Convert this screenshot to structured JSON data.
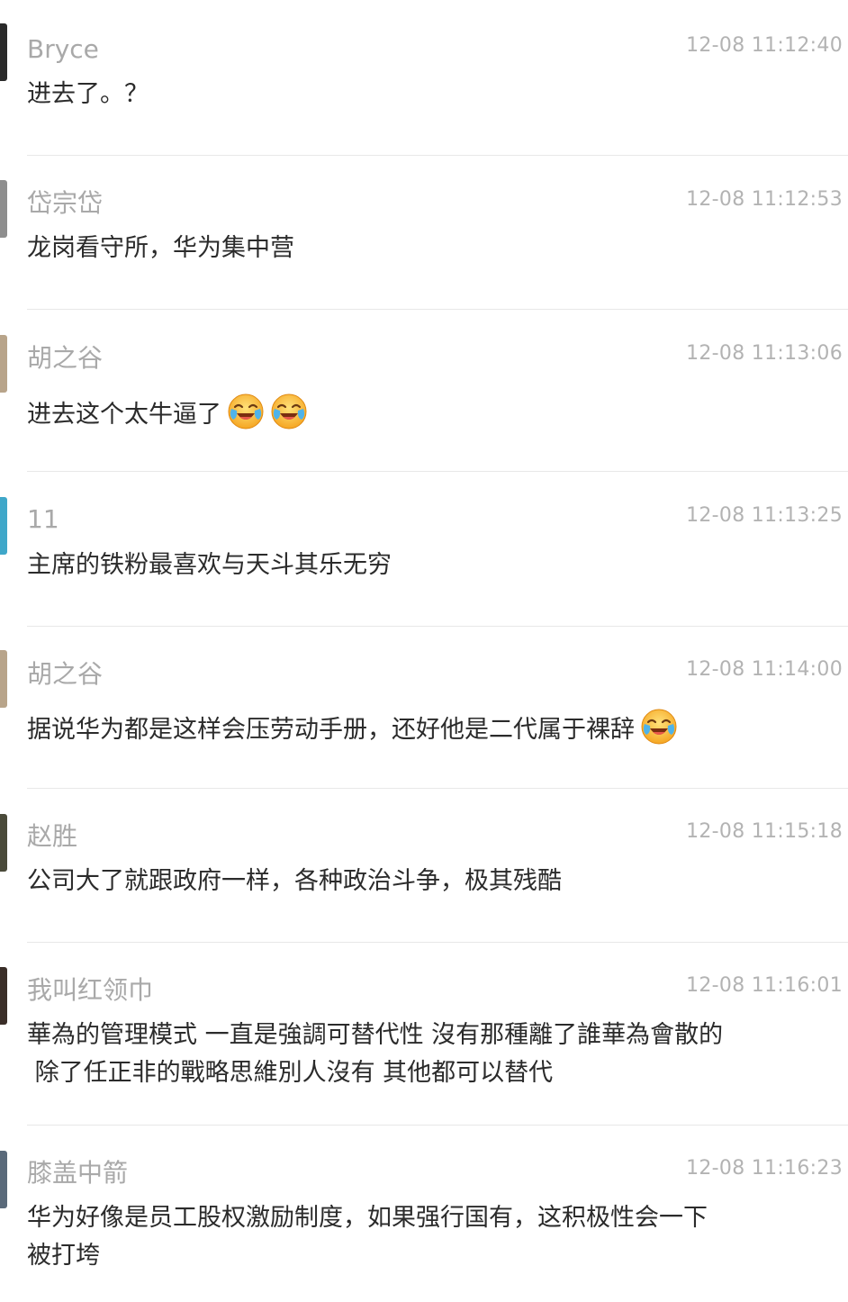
{
  "comments": [
    {
      "user": "Bryce",
      "time": "12-08 11:12:40",
      "text": "进去了。？",
      "avatar_color": "#2a2a2a"
    },
    {
      "user": "岱宗岱",
      "time": "12-08 11:12:53",
      "text": "龙岗看守所，华为集中营",
      "avatar_color": "#8e8e8e"
    },
    {
      "user": "胡之谷",
      "time": "12-08 11:13:06",
      "text": "进去这个太牛逼了",
      "emojis": [
        "crying-laughing-emoji",
        "crying-laughing-emoji"
      ],
      "avatar_color": "#b8a48a"
    },
    {
      "user": "11",
      "time": "12-08 11:13:25",
      "text": "主席的铁粉最喜欢与天斗其乐无穷",
      "avatar_color": "#3fa7c9"
    },
    {
      "user": "胡之谷",
      "time": "12-08 11:14:00",
      "text": "据说华为都是这样会压劳动手册，还好他是二代属于裸辞",
      "emojis": [
        "crying-laughing-emoji"
      ],
      "avatar_color": "#b8a48a"
    },
    {
      "user": "赵胜",
      "time": "12-08 11:15:18",
      "text": "公司大了就跟政府一样，各种政治斗争，极其残酷",
      "avatar_color": "#4a4a3a"
    },
    {
      "user": "我叫红领巾",
      "time": "12-08 11:16:01",
      "text": "華為的管理模式 一直是強調可替代性 沒有那種離了誰華為會散的\n 除了任正非的戰略思維別人沒有 其他都可以替代",
      "avatar_color": "#3a2e28"
    },
    {
      "user": "膝盖中箭",
      "time": "12-08 11:16:23",
      "text": "华为好像是员工股权激励制度，如果强行国有，这积极性会一下\n被打垮",
      "avatar_color": "#5a6a7a"
    }
  ]
}
